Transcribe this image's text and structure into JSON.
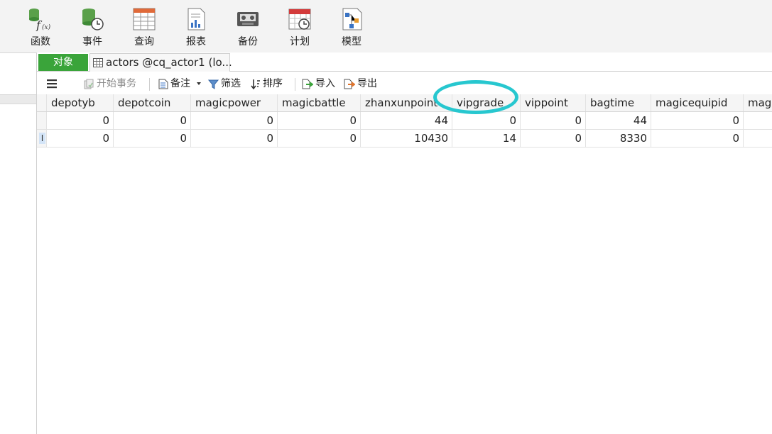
{
  "ribbon": {
    "function": "函数",
    "event": "事件",
    "query": "查询",
    "report": "报表",
    "backup": "备份",
    "schedule": "计划",
    "model": "模型"
  },
  "tabs": {
    "objects": "对象",
    "active": "actors @cq_actor1 (lo..."
  },
  "toolbar": {
    "begin_transaction": "开始事务",
    "memo": "备注",
    "filter": "筛选",
    "sort": "排序",
    "import": "导入",
    "export": "导出"
  },
  "grid": {
    "columns": [
      "depotyb",
      "depotcoin",
      "magicpower",
      "magicbattle",
      "zhanxunpoint",
      "vipgrade",
      "vippoint",
      "bagtime",
      "magicequipid",
      "magi"
    ],
    "rows": [
      [
        "0",
        "0",
        "0",
        "0",
        "44",
        "0",
        "0",
        "44",
        "0"
      ],
      [
        "0",
        "0",
        "0",
        "0",
        "10430",
        "14",
        "0",
        "8330",
        "0"
      ]
    ],
    "cursor_glyph": "I"
  },
  "highlight": {
    "color": "#27c7cf",
    "target": "vipgrade"
  }
}
